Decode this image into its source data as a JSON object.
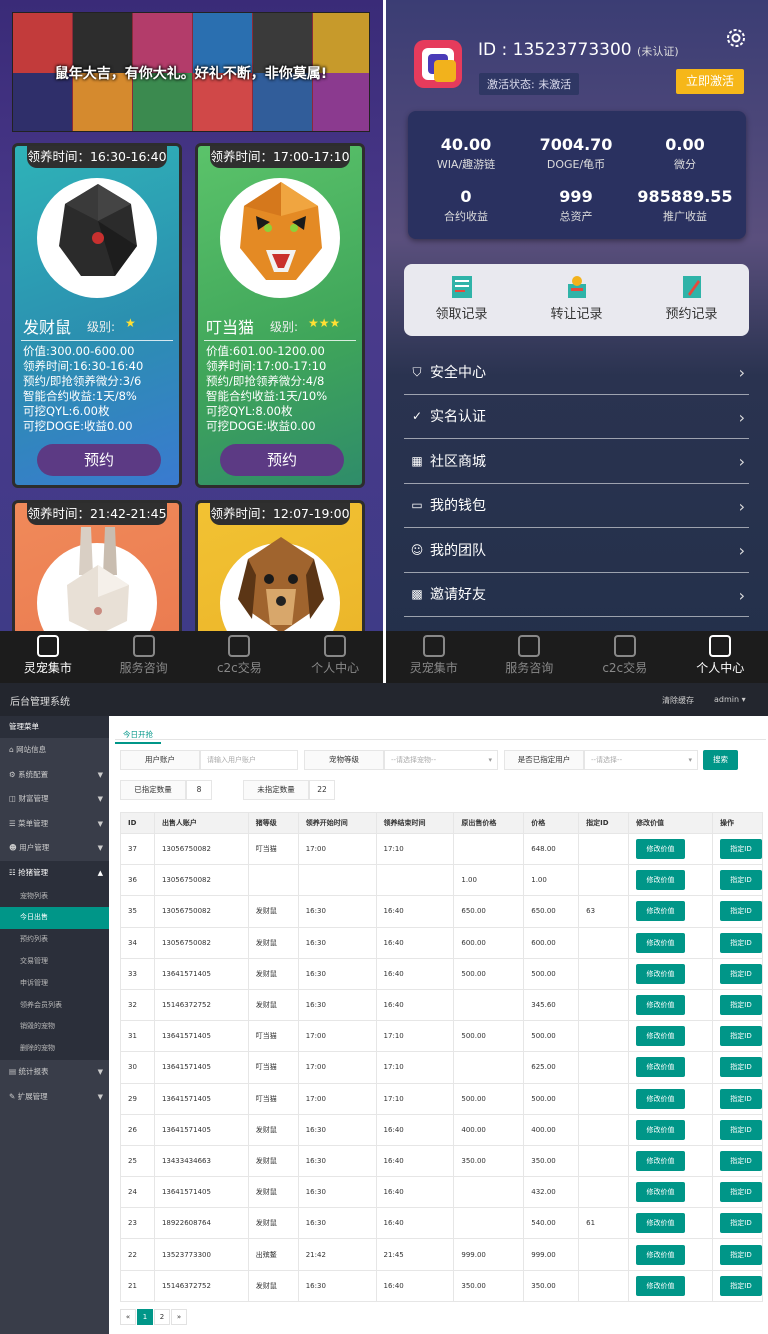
{
  "market": {
    "banner_text": "鼠年大吉，有你大礼。好礼不断，非你莫属!",
    "cards": [
      {
        "time": "领养时间：16:30-16:40",
        "name": "发财鼠",
        "level_label": "级别:",
        "stars": "★",
        "lines": [
          "价值:300.00-600.00",
          "领养时间:16:30-16:40",
          "预约/即抢领养微分:3/6",
          "智能合约收益:1天/8%",
          "可挖QYL:6.00枚",
          "可挖DOGE:收益0.00"
        ],
        "button": "预约"
      },
      {
        "time": "领养时间：17:00-17:10",
        "name": "叮当猫",
        "level_label": "级别:",
        "stars": "★★★",
        "lines": [
          "价值:601.00-1200.00",
          "领养时间:17:00-17:10",
          "预约/即抢领养微分:4/8",
          "智能合约收益:1天/10%",
          "可挖QYL:8.00枚",
          "可挖DOGE:收益0.00"
        ],
        "button": "预约"
      },
      {
        "time": "领养时间：21:42-21:45"
      },
      {
        "time": "领养时间：12:07-19:00"
      }
    ],
    "tabs": [
      "灵宠集市",
      "服务咨询",
      "c2c交易",
      "个人中心"
    ]
  },
  "profile": {
    "id_text": "ID : 13523773300",
    "verify": "(未认证)",
    "activation": "激活状态: 未激活",
    "activate_button": "立即激活",
    "stats": [
      {
        "value": "40.00",
        "label": "WIA/趣游链"
      },
      {
        "value": "7004.70",
        "label": "DOGE/龟币"
      },
      {
        "value": "0.00",
        "label": "微分"
      },
      {
        "value": "0",
        "label": "合约收益"
      },
      {
        "value": "999",
        "label": "总资产"
      },
      {
        "value": "985889.55",
        "label": "推广收益"
      }
    ],
    "records": [
      "领取记录",
      "转让记录",
      "预约记录"
    ],
    "menu": [
      "安全中心",
      "实名认证",
      "社区商城",
      "我的钱包",
      "我的团队",
      "邀请好友"
    ],
    "tabs": [
      "灵宠集市",
      "服务咨询",
      "c2c交易",
      "个人中心"
    ]
  },
  "admin": {
    "brand": "后台管理系统",
    "clear_cache": "清除缓存",
    "user": "admin ▾",
    "menu_head": "管理菜单",
    "menu": [
      "网站信息",
      "系统配置",
      "财富管理",
      "菜单管理",
      "用户管理",
      "抢猪管理"
    ],
    "submenu": [
      "宠物列表",
      "今日出售",
      "预约列表",
      "交易管理",
      "申诉管理",
      "领养会员列表",
      "销毁的宠物",
      "删除的宠物"
    ],
    "menu_after": [
      "统计报表",
      "扩展管理"
    ],
    "tab": "今日开抢",
    "filters": {
      "user_label": "用户账户",
      "user_placeholder": "请输入用户账户",
      "level_label": "宠物等级",
      "level_placeholder": "--请选择宠物--",
      "assigned_label": "是否已指定用户",
      "assigned_placeholder": "--请选择--",
      "search": "搜索",
      "assigned_count_label": "已指定数量",
      "assigned_count": "8",
      "unassigned_count_label": "未指定数量",
      "unassigned_count": "22"
    },
    "columns": [
      "ID",
      "出售人账户",
      "猪等级",
      "领养开始时间",
      "领养结束时间",
      "原出售价格",
      "价格",
      "指定ID",
      "修改价值",
      "操作"
    ],
    "edit_label": "修改价值",
    "assign_label": "指定ID",
    "rows": [
      [
        "37",
        "13056750082",
        "叮当猫",
        "17:00",
        "17:10",
        "",
        "648.00",
        ""
      ],
      [
        "36",
        "13056750082",
        "",
        "",
        "",
        "1.00",
        "1.00",
        ""
      ],
      [
        "35",
        "13056750082",
        "发财鼠",
        "16:30",
        "16:40",
        "650.00",
        "650.00",
        "63"
      ],
      [
        "34",
        "13056750082",
        "发财鼠",
        "16:30",
        "16:40",
        "600.00",
        "600.00",
        ""
      ],
      [
        "33",
        "13641571405",
        "发财鼠",
        "16:30",
        "16:40",
        "500.00",
        "500.00",
        ""
      ],
      [
        "32",
        "15146372752",
        "发财鼠",
        "16:30",
        "16:40",
        "",
        "345.60",
        ""
      ],
      [
        "31",
        "13641571405",
        "叮当猫",
        "17:00",
        "17:10",
        "500.00",
        "500.00",
        ""
      ],
      [
        "30",
        "13641571405",
        "叮当猫",
        "17:00",
        "17:10",
        "",
        "625.00",
        ""
      ],
      [
        "29",
        "13641571405",
        "叮当猫",
        "17:00",
        "17:10",
        "500.00",
        "500.00",
        ""
      ],
      [
        "26",
        "13641571405",
        "发财鼠",
        "16:30",
        "16:40",
        "400.00",
        "400.00",
        ""
      ],
      [
        "25",
        "13433434663",
        "发财鼠",
        "16:30",
        "16:40",
        "350.00",
        "350.00",
        ""
      ],
      [
        "24",
        "13641571405",
        "发财鼠",
        "16:30",
        "16:40",
        "",
        "432.00",
        ""
      ],
      [
        "23",
        "18922608764",
        "发财鼠",
        "16:30",
        "16:40",
        "",
        "540.00",
        "61"
      ],
      [
        "22",
        "13523773300",
        "出殡鳌",
        "21:42",
        "21:45",
        "999.00",
        "999.00",
        ""
      ],
      [
        "21",
        "15146372752",
        "发财鼠",
        "16:30",
        "16:40",
        "350.00",
        "350.00",
        ""
      ]
    ],
    "pager": [
      "«",
      "1",
      "2",
      "»"
    ]
  }
}
